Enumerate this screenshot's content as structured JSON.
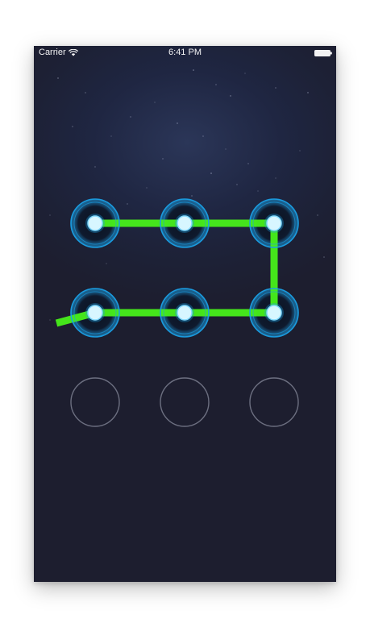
{
  "status_bar": {
    "carrier": "Carrier",
    "time": "6:41 PM",
    "wifi_icon": "wifi-icon",
    "battery_icon": "battery-icon"
  },
  "pattern_lock": {
    "grid_rows": 3,
    "grid_cols": 3,
    "selected_nodes": [
      1,
      2,
      3,
      6,
      5,
      4
    ],
    "trail_extends_from_node": 4,
    "colors": {
      "line": "#48f01a",
      "node_ring": "#1aa0e6",
      "node_dot": "#d7f6ff",
      "idle_ring": "#6c6f80"
    }
  }
}
